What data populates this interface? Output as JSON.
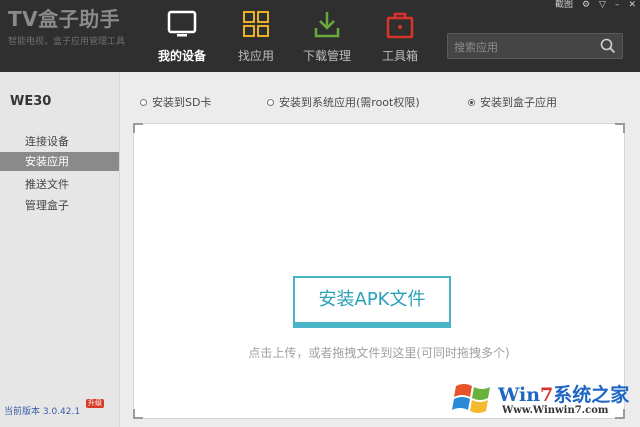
{
  "app": {
    "logo_title": "TV盒子助手",
    "logo_subtitle": "智能电视，盒子应用管理工具"
  },
  "window_controls": {
    "screenshot_label": "截图"
  },
  "nav": {
    "tabs": [
      {
        "label": "我的设备",
        "icon": "tv-icon",
        "active": true
      },
      {
        "label": "找应用",
        "icon": "grid-icon",
        "active": false
      },
      {
        "label": "下载管理",
        "icon": "download-icon",
        "active": false
      },
      {
        "label": "工具箱",
        "icon": "toolbox-icon",
        "active": false
      }
    ]
  },
  "search": {
    "placeholder": "搜索应用"
  },
  "sidebar": {
    "device_name": "WE30",
    "items": [
      {
        "label": "连接设备",
        "active": false
      },
      {
        "label": "安装应用",
        "active": true
      },
      {
        "label": "推送文件",
        "active": false
      },
      {
        "label": "管理盒子",
        "active": false
      }
    ],
    "version": "当前版本 3.0.42.1",
    "upgrade_badge": "升级"
  },
  "install_options": [
    {
      "label": "安装到SD卡",
      "checked": false
    },
    {
      "label": "安装到系统应用(需root权限)",
      "checked": false
    },
    {
      "label": "安装到盒子应用",
      "checked": true
    }
  ],
  "drop_zone": {
    "button_label": "安装APK文件",
    "hint": "点击上传，或者拖拽文件到这里(可同时拖拽多个)"
  },
  "watermark": {
    "brand_prefix": "Win",
    "brand_seven": "7",
    "brand_suffix": "系统之家",
    "url": "Www.Winwin7.com"
  },
  "colors": {
    "header_bg": "#2f2f2f",
    "accent": "#49b4c8",
    "nav_icon_yellow": "#e8b12a",
    "nav_icon_green": "#6aa83b",
    "nav_icon_red": "#d8322a"
  }
}
